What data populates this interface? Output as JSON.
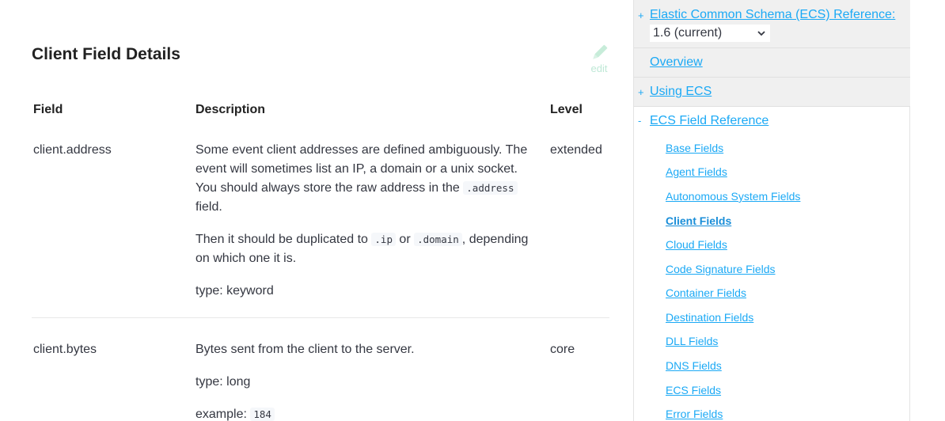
{
  "page": {
    "title": "Client Field Details",
    "edit_label": "edit"
  },
  "table": {
    "headers": {
      "field": "Field",
      "description": "Description",
      "level": "Level"
    },
    "rows": [
      {
        "field": "client.address",
        "level": "extended",
        "desc1_a": "Some event client addresses are defined ambiguously. The event will sometimes list an IP, a domain or a unix socket. You should always store the raw address in the",
        "desc1_code": ".address",
        "desc1_b": "field.",
        "desc2_a": "Then it should be duplicated to",
        "desc2_code1": ".ip",
        "desc2_or": "or",
        "desc2_code2": ".domain",
        "desc2_comma": ",",
        "desc2_b": "depending on which one it is.",
        "type": "type: keyword"
      },
      {
        "field": "client.bytes",
        "level": "core",
        "desc1": "Bytes sent from the client to the server.",
        "type": "type: long",
        "example_label": "example:",
        "example_code": "184"
      }
    ]
  },
  "sidebar": {
    "reference_title": "Elastic Common Schema (ECS) Reference:",
    "version": "1.6 (current)",
    "overview": "Overview",
    "using_ecs": "Using ECS",
    "field_reference": "ECS Field Reference",
    "toggle_plus": "+",
    "toggle_minus": "-",
    "items": [
      {
        "label": "Base Fields",
        "active": false
      },
      {
        "label": "Agent Fields",
        "active": false
      },
      {
        "label": "Autonomous System Fields",
        "active": false
      },
      {
        "label": "Client Fields",
        "active": true
      },
      {
        "label": "Cloud Fields",
        "active": false
      },
      {
        "label": "Code Signature Fields",
        "active": false
      },
      {
        "label": "Container Fields",
        "active": false
      },
      {
        "label": "Destination Fields",
        "active": false
      },
      {
        "label": "DLL Fields",
        "active": false
      },
      {
        "label": "DNS Fields",
        "active": false
      },
      {
        "label": "ECS Fields",
        "active": false
      },
      {
        "label": "Error Fields",
        "active": false
      }
    ]
  },
  "colors": {
    "link": "#1ba9f5",
    "sidebar_bg": "#f0f0f0",
    "edit": "#bfe8d6"
  }
}
